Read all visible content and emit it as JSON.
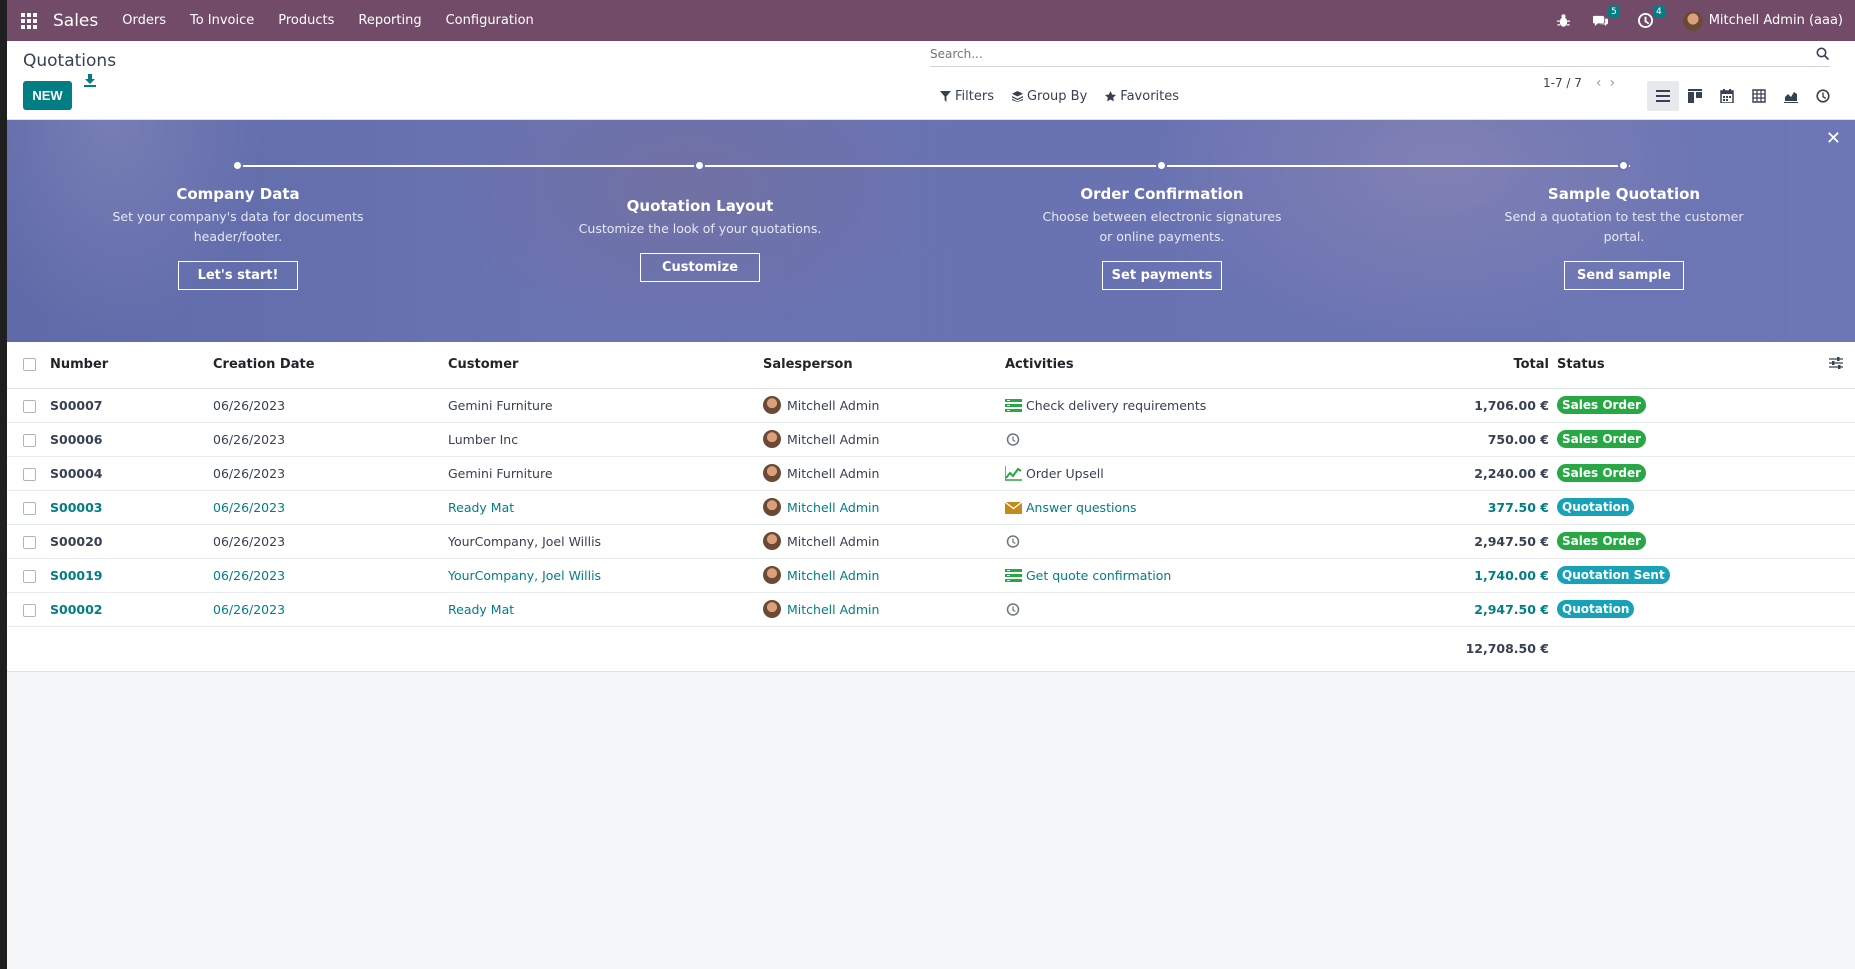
{
  "navbar": {
    "app_name": "Sales",
    "menu": [
      "Orders",
      "To Invoice",
      "Products",
      "Reporting",
      "Configuration"
    ],
    "messages_count": "5",
    "activities_count": "4",
    "user_name": "Mitchell Admin (aaa)"
  },
  "control": {
    "title": "Quotations",
    "new_label": "NEW",
    "search_placeholder": "Search...",
    "filters_label": "Filters",
    "groupby_label": "Group By",
    "favorites_label": "Favorites",
    "pager": "1-7 / 7"
  },
  "banner": {
    "steps": [
      {
        "title": "Company Data",
        "desc_line1": "Set your company's data for documents",
        "desc_line2": "header/footer.",
        "button": "Let's start!"
      },
      {
        "title": "Quotation Layout",
        "desc_line1": "Customize the look of your quotations.",
        "desc_line2": "",
        "button": "Customize"
      },
      {
        "title": "Order Confirmation",
        "desc_line1": "Choose between electronic signatures",
        "desc_line2": "or online payments.",
        "button": "Set payments"
      },
      {
        "title": "Sample Quotation",
        "desc_line1": "Send a quotation to test the customer",
        "desc_line2": "portal.",
        "button": "Send sample"
      }
    ]
  },
  "table": {
    "headers": {
      "number": "Number",
      "date": "Creation Date",
      "customer": "Customer",
      "salesperson": "Salesperson",
      "activities": "Activities",
      "total": "Total",
      "status": "Status"
    },
    "rows": [
      {
        "number": "S00007",
        "date": "06/26/2023",
        "customer": "Gemini Furniture",
        "salesperson": "Mitchell Admin",
        "activity": "Check delivery requirements",
        "activity_icon": "list-icon",
        "total": "1,706.00 €",
        "status": "Sales Order"
      },
      {
        "number": "S00006",
        "date": "06/26/2023",
        "customer": "Lumber Inc",
        "salesperson": "Mitchell Admin",
        "activity": "",
        "activity_icon": "clock-icon",
        "total": "750.00 €",
        "status": "Sales Order"
      },
      {
        "number": "S00004",
        "date": "06/26/2023",
        "customer": "Gemini Furniture",
        "salesperson": "Mitchell Admin",
        "activity": "Order Upsell",
        "activity_icon": "chart-icon",
        "total": "2,240.00 €",
        "status": "Sales Order"
      },
      {
        "number": "S00003",
        "date": "06/26/2023",
        "customer": "Ready Mat",
        "salesperson": "Mitchell Admin",
        "activity": "Answer questions",
        "activity_icon": "envelope-icon",
        "total": "377.50 €",
        "status": "Quotation"
      },
      {
        "number": "S00020",
        "date": "06/26/2023",
        "customer": "YourCompany, Joel Willis",
        "salesperson": "Mitchell Admin",
        "activity": "",
        "activity_icon": "clock-icon",
        "total": "2,947.50 €",
        "status": "Sales Order"
      },
      {
        "number": "S00019",
        "date": "06/26/2023",
        "customer": "YourCompany, Joel Willis",
        "salesperson": "Mitchell Admin",
        "activity": "Get quote confirmation",
        "activity_icon": "list-icon",
        "total": "1,740.00 €",
        "status": "Quotation Sent"
      },
      {
        "number": "S00002",
        "date": "06/26/2023",
        "customer": "Ready Mat",
        "salesperson": "Mitchell Admin",
        "activity": "",
        "activity_icon": "clock-icon",
        "total": "2,947.50 €",
        "status": "Quotation"
      }
    ],
    "grand_total": "12,708.50 €"
  },
  "colors": {
    "navbar": "#714b67",
    "primary": "#017e84",
    "sales_order": "#28a745",
    "quotation": "#17a2b8"
  }
}
